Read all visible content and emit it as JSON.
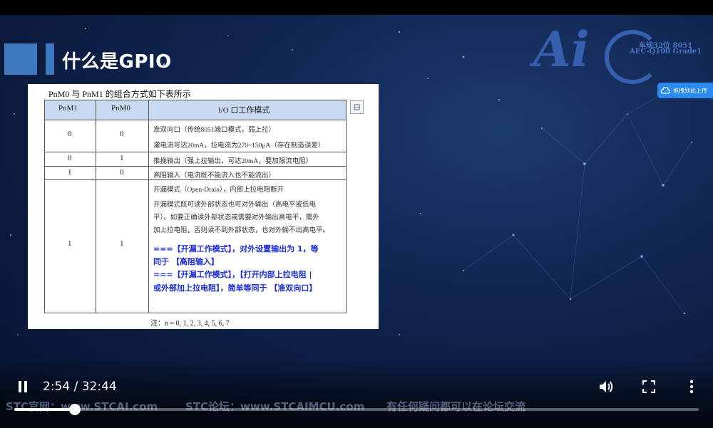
{
  "slide": {
    "title": "什么是GPIO",
    "logo_text": "Ai",
    "logo_line1": "车规32位 8051",
    "logo_line2": "AEC-Q100 Grade1",
    "upload_label": "拖拽到此上传",
    "footer_left": "STC官网：www.STCAI.com",
    "footer_mid": "STC论坛：www.STCAIMCU.com",
    "footer_right": "有任何疑问都可以在论坛交流"
  },
  "doc": {
    "caption": "PnM0 与 PnM1 的组合方式如下表所示",
    "headers": [
      "PnM1",
      "PnM0",
      "I/O 口工作模式"
    ],
    "rows": [
      {
        "m1": "0",
        "m0": "0",
        "lines": [
          "准双向口（传统8051端口模式，弱上拉）",
          "灌电流可达20mA，拉电流为270~150μA（存在制造误差）"
        ]
      },
      {
        "m1": "0",
        "m0": "1",
        "lines": [
          "推挽输出（强上拉输出，可达20mA，要加限流电阻）"
        ]
      },
      {
        "m1": "1",
        "m0": "0",
        "lines": [
          "高阻输入（电流既不能流入也不能流出）"
        ]
      },
      {
        "m1": "1",
        "m0": "1",
        "lines": [
          "开漏模式（Open-Drain），内部上拉电阻断开",
          "开漏模式既可读外部状态也可对外输出（高电平或低电",
          "平）。如要正确读外部状态或需要对外输出高电平，需外",
          "加上拉电阻，否则读不到外部状态，也对外输不出高电平。"
        ],
        "notes": [
          "===【开漏工作模式】，对外设置输出为 1，等",
          "同于 【高阻输入】",
          "===【开漏工作模式】，【打开内部上拉电阻 |",
          "或外部加上拉电阻】，简单等同于 【准双向口】"
        ]
      }
    ],
    "footnote": "注：n = 0, 1, 2, 3, 4, 5, 6, 7"
  },
  "player": {
    "time": "2:54 / 32:44",
    "progress_fraction": 0.0886,
    "icons": [
      "pause-icon",
      "volume-icon",
      "fullscreen-icon",
      "more-vert-icon"
    ]
  }
}
